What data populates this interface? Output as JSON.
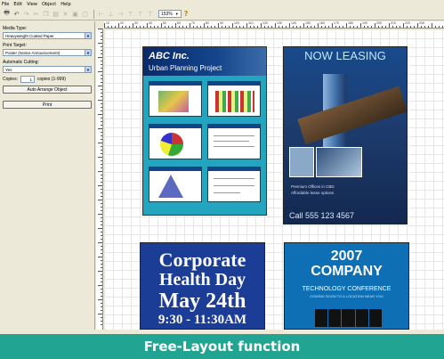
{
  "menu": [
    "File",
    "Edit",
    "View",
    "Object",
    "Help"
  ],
  "toolbar": {
    "zoom": "153%",
    "help": "?"
  },
  "panel": {
    "media_type_label": "Media Type:",
    "media_type_value": "Heavyweight Coated Paper",
    "print_target_label": "Print Target:",
    "print_target_value": "Poster (Notice Announcement)",
    "auto_cutting_label": "Automatic Cutting:",
    "auto_cutting_value": "Yes",
    "copies_label": "Copies:",
    "copies_value": "1",
    "copies_range": "copies (1-999)",
    "auto_arrange_label": "Auto Arrange Object",
    "print_label": "Print"
  },
  "docs": {
    "d1_title": "ABC Inc.",
    "d1_subtitle": "Urban Planning Project",
    "d2_title": "NOW LEASING",
    "d2_line1": "Premium Offices in CBD",
    "d2_line2": "Affordable lease options",
    "d2_phone": "Call 555 123 4567",
    "d3_line1": "Corporate",
    "d3_line2": "Health Day",
    "d3_line3": "May 24th",
    "d3_line4": "9:30 - 11:30AM",
    "d4_year": "2007",
    "d4_company": "COMPANY",
    "d4_conf": "TECHNOLOGY CONFERENCE",
    "d4_sub": "COMING SOON TO A LOCATION NEAR YOU"
  },
  "ruler_ticks": [
    "10",
    "20",
    "30",
    "40",
    "50",
    "60",
    "70",
    "80",
    "90",
    "100",
    "110",
    "120",
    "130",
    "140",
    "150",
    "160",
    "170",
    "180",
    "190",
    "200",
    "210",
    "220",
    "230"
  ],
  "banner": "Free-Layout function",
  "colors": {
    "banner": "#21a592",
    "doc1_bg": "#24a5bf",
    "doc3_bg": "#1c3d96",
    "doc4_bg": "#0e6fb4"
  }
}
